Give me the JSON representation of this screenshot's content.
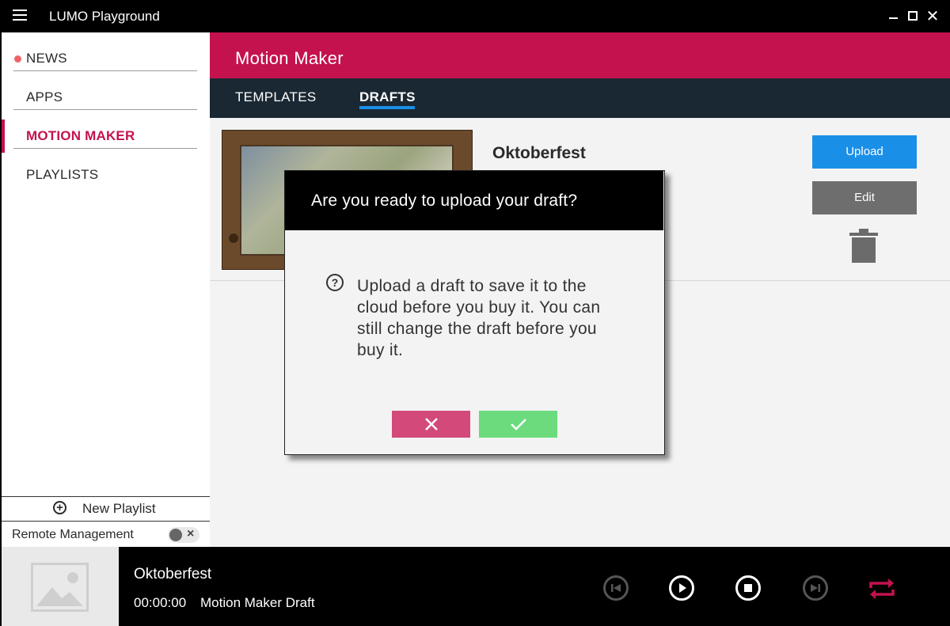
{
  "window": {
    "title": "LUMO Playground",
    "close_glyph": "✕"
  },
  "sidebar": {
    "items": [
      {
        "label": "NEWS",
        "has_dot": true
      },
      {
        "label": "APPS"
      },
      {
        "label": "MOTION MAKER",
        "active": true
      },
      {
        "label": "PLAYLISTS"
      }
    ],
    "new_playlist": "New Playlist",
    "remote_management": "Remote Management"
  },
  "main": {
    "title": "Motion Maker",
    "tabs": [
      {
        "label": "TEMPLATES"
      },
      {
        "label": "DRAFTS",
        "active": true
      }
    ],
    "draft": {
      "name": "Oktoberfest",
      "upload_label": "Upload",
      "edit_label": "Edit"
    }
  },
  "dialog": {
    "title": "Are you ready to upload your draft?",
    "body": "Upload a draft to save it to the cloud before you buy it. You can still change the draft before you buy it.",
    "help_glyph": "?"
  },
  "player": {
    "title": "Oktoberfest",
    "time": "00:00:00",
    "subtitle": "Motion Maker Draft"
  },
  "colors": {
    "accent": "#c4124f",
    "header_dark": "#1a2833",
    "upload_blue": "#1a8fe8",
    "cancel_pink": "#d2497a",
    "confirm_green": "#6bdb7d"
  }
}
